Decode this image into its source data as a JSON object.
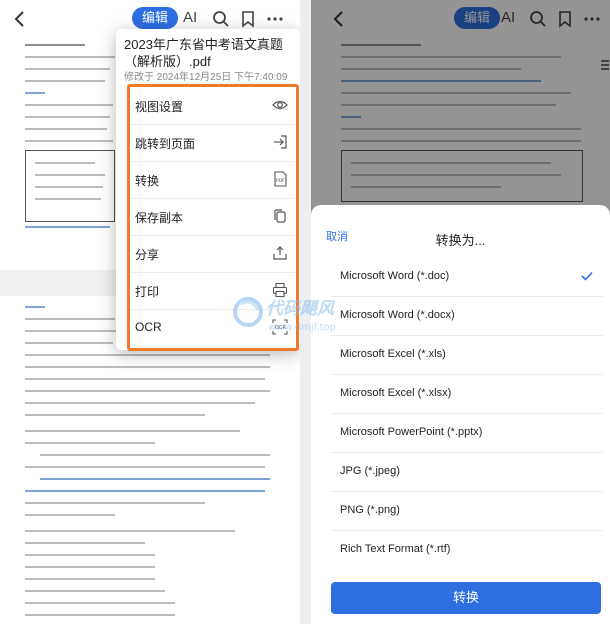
{
  "left_toolbar": {
    "edit_label": "编辑",
    "ai_label": "AI"
  },
  "menu": {
    "title": "2023年广东省中考语文真题（解析版）.pdf",
    "modified": "修改于 2024年12月25日 下午7:40:09",
    "items": [
      {
        "label": "视图设置",
        "icon": "eye-icon"
      },
      {
        "label": "跳转到页面",
        "icon": "goto-page-icon"
      },
      {
        "label": "转换",
        "icon": "pdf-convert-icon"
      },
      {
        "label": "保存副本",
        "icon": "copy-icon"
      },
      {
        "label": "分享",
        "icon": "share-icon"
      },
      {
        "label": "打印",
        "icon": "printer-icon"
      },
      {
        "label": "OCR",
        "icon": "ocr-icon"
      }
    ]
  },
  "right_toolbar": {
    "edit_label": "编辑",
    "ai_label": "AI"
  },
  "convert_sheet": {
    "cancel_label": "取消",
    "title": "转换为...",
    "options": [
      {
        "label": "Microsoft Word (*.doc)",
        "selected": true
      },
      {
        "label": "Microsoft Word (*.docx)",
        "selected": false
      },
      {
        "label": "Microsoft Excel (*.xls)",
        "selected": false
      },
      {
        "label": "Microsoft Excel (*.xlsx)",
        "selected": false
      },
      {
        "label": "Microsoft PowerPoint (*.pptx)",
        "selected": false
      },
      {
        "label": "JPG (*.jpeg)",
        "selected": false
      },
      {
        "label": "PNG (*.png)",
        "selected": false
      },
      {
        "label": "Rich Text Format (*.rtf)",
        "selected": false
      }
    ],
    "convert_label": "转换"
  },
  "watermark": {
    "title": "代码飓风",
    "url": "www.dmjf.top"
  },
  "colors": {
    "accent": "#2d6fe0",
    "highlight_border": "#f07a2c"
  }
}
